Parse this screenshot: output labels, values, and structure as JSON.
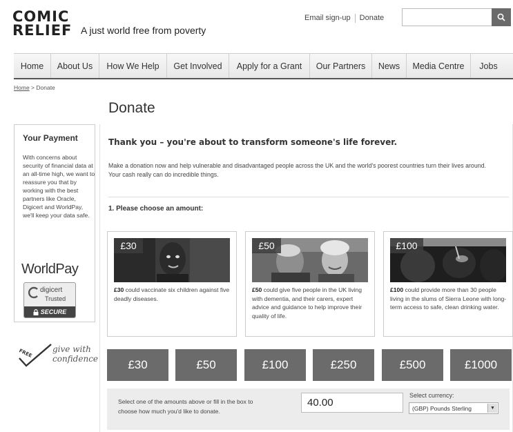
{
  "header": {
    "logo_line1": "COMIC",
    "logo_line2": "RELIEF",
    "tagline": "A just world free from poverty",
    "email_signup": "Email sign-up",
    "donate_link": "Donate",
    "search_placeholder": "",
    "search_icon": "search-icon"
  },
  "nav": {
    "items": [
      {
        "label": "Home"
      },
      {
        "label": "About Us"
      },
      {
        "label": "How We Help"
      },
      {
        "label": "Get Involved"
      },
      {
        "label": "Apply for a Grant"
      },
      {
        "label": "Our Partners"
      },
      {
        "label": "News"
      },
      {
        "label": "Media Centre"
      },
      {
        "label": "Jobs"
      }
    ]
  },
  "breadcrumb": {
    "home": "Home",
    "separator": " > ",
    "current": "Donate"
  },
  "page_title": "Donate",
  "sidebar": {
    "title": "Your Payment",
    "text": "With concerns about security of financial data at an all-time high, we want to reassure you that by working with the best partners like Oracle, Digicert and WorldPay, we'll keep your data safe.",
    "worldpay": "WorldPay",
    "digicert_name": "digicert",
    "digicert_trusted": "Trusted",
    "digicert_secure": "SECURE",
    "give_logo": "FREE",
    "give_text": "give with confidence"
  },
  "main": {
    "thanks_heading": "Thank you – you're about to transform someone's life forever.",
    "intro_line1": "Make a donation now and help vulnerable and disadvantaged people across the UK and the world's poorest countries turn their lives around.",
    "intro_line2": "Your cash really can do incredible things.",
    "step1_label": "1. Please choose an amount:",
    "cards": [
      {
        "badge": "£30",
        "amount": "£30",
        "text": " could vaccinate six children against five deadly diseases."
      },
      {
        "badge": "£50",
        "amount": "£50",
        "text": " could give five people in the UK living with dementia, and their carers, expert advice and guidance to help improve their quality of life."
      },
      {
        "badge": "£100",
        "amount": "£100",
        "text": " could provide more than 30 people living in the slums of Sierra Leone with long-term access to safe, clean drinking water."
      }
    ],
    "amount_buttons": [
      "£30",
      "£50",
      "£100",
      "£250",
      "£500",
      "£1000"
    ],
    "custom_amount_text": "Select one of the amounts above or fill in the box to choose how much you'd like to donate.",
    "custom_amount_value": "40.00",
    "currency_label": "Select currency:",
    "currency_selected": "(GBP) Pounds Sterling"
  }
}
